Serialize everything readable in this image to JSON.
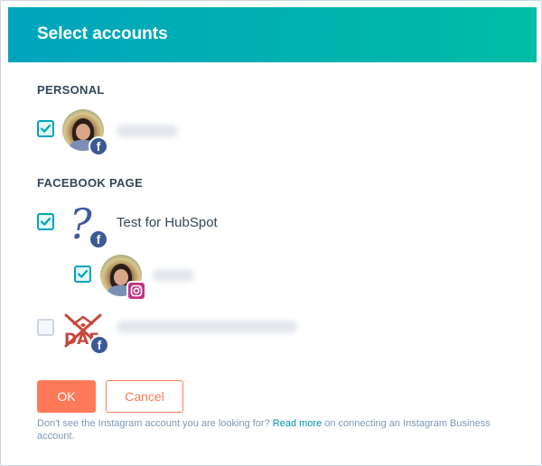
{
  "header": {
    "title": "Select accounts"
  },
  "sections": {
    "personal": {
      "label": "PERSONAL"
    },
    "facebook_page": {
      "label": "FACEBOOK PAGE"
    }
  },
  "accounts": {
    "personal_profile": {
      "checked": true,
      "network": "facebook",
      "name_visible": false
    },
    "page_test": {
      "checked": true,
      "network": "facebook",
      "name": "Test for HubSpot"
    },
    "instagram_linked": {
      "checked": true,
      "network": "instagram",
      "name_visible": false
    },
    "page_other": {
      "checked": false,
      "network": "facebook",
      "name_visible": false,
      "logo_text": "DAF"
    }
  },
  "icons": {
    "facebook": "facebook-icon",
    "instagram": "instagram-icon",
    "check": "checkmark-icon",
    "placeholder": "question-mark-icon"
  },
  "buttons": {
    "ok": "OK",
    "cancel": "Cancel"
  },
  "footer": {
    "text_before": "Don't see the Instagram account you are looking for?",
    "link": "Read more",
    "text_after": "on connecting an Instagram Business account."
  },
  "colors": {
    "header_start": "#00a4bd",
    "header_end": "#00bda5",
    "primary": "#ff7a59",
    "checkbox": "#00a4bd",
    "facebook": "#3b5998",
    "instagram": "#c13584",
    "link": "#0091ae"
  }
}
